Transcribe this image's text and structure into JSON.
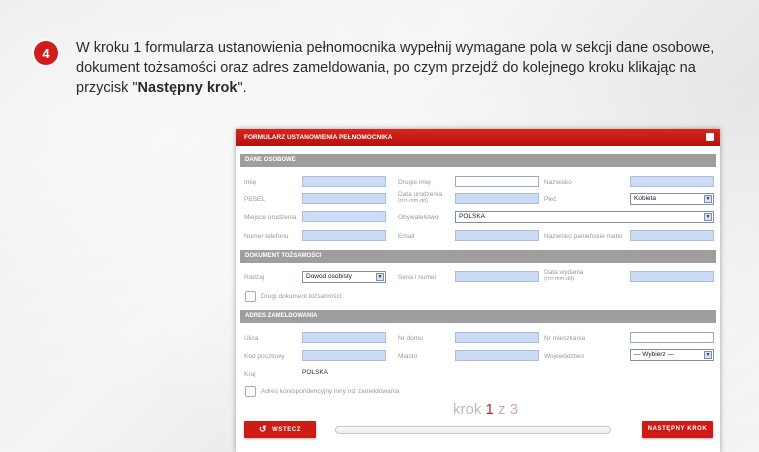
{
  "step": {
    "number": "4",
    "text_before": "W kroku 1 formularza ustanowienia pełnomocnika wypełnij wymagane pola w sekcji dane osobowe, dokument tożsamości oraz adres zameldowania, po czym przejdź do kolejnego kroku klikając na przycisk \"",
    "text_bold": "Następny krok",
    "text_after": "\"."
  },
  "form": {
    "title": "FORMULARZ USTANOWIENIA PEŁNOMOCNIKA",
    "help": "?",
    "sections": {
      "personal": "DANE OSOBOWE",
      "document": "DOKUMENT TOŻSAMOŚCI",
      "address": "ADRES ZAMELDOWANIA"
    },
    "personal": {
      "first_name": "Imię",
      "second_name": "Drugie imię",
      "last_name": "Nazwisko",
      "pesel": "PESEL",
      "birth_date": "Data urodzenia",
      "birth_date_format": "(rrrr-mm-dd)",
      "sex": "Płeć",
      "sex_value": "Kobieta",
      "birth_place": "Miejsce urodzenia",
      "citizenship": "Obywatelstwo",
      "citizenship_value": "POLSKA",
      "phone": "Numer telefonu",
      "email": "Email",
      "maiden_name": "Nazwisko panieńskie matki"
    },
    "document": {
      "type": "Rodzaj",
      "type_value": "Dowód osobisty",
      "series_number": "Seria i numer",
      "issue_date": "Data wydania",
      "issue_date_format": "(rrrr-mm-dd)",
      "second_document": "Drugi dokument tożsamości"
    },
    "address": {
      "street": "Ulica",
      "house_no": "Nr domu",
      "flat_no": "Nr mieszkania",
      "postal_code": "Kod pocztowy",
      "city": "Miasto",
      "voivodeship": "Województwo",
      "voivodeship_value": "— Wybierz —",
      "country": "Kraj",
      "country_value": "POLSKA",
      "correspondence": "Adres korespondencyjny inny niż zameldowania"
    },
    "steps": {
      "prefix": "krok",
      "current": "1",
      "separator": "z",
      "total": "3"
    },
    "back_button": "WSTECZ",
    "back_icon": "undo-arrow-icon",
    "next_button": "NASTĘPNY KROK"
  }
}
